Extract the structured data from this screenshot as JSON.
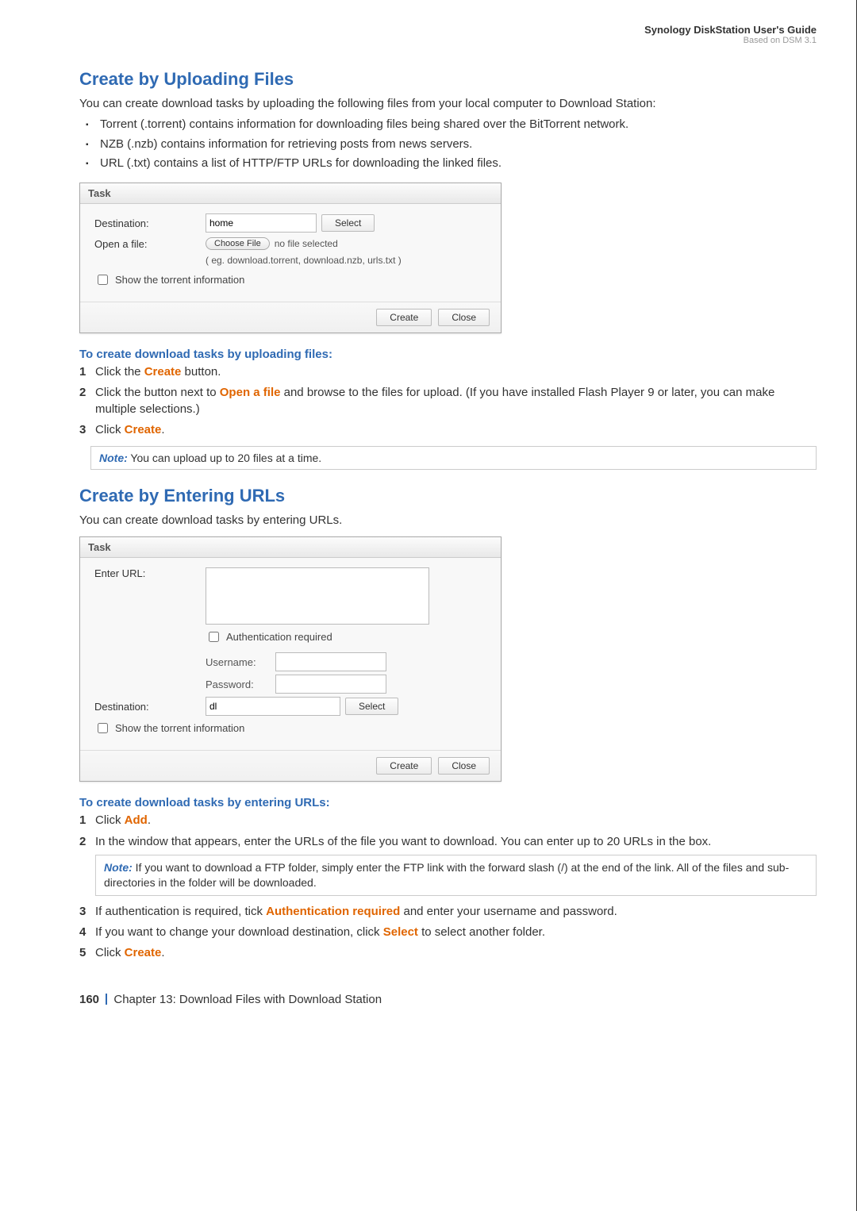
{
  "header": {
    "title": "Synology DiskStation User's Guide",
    "subtitle": "Based on DSM 3.1"
  },
  "section1": {
    "title": "Create by Uploading Files",
    "intro": "You can create download tasks by uploading the following files from your local computer to Download Station:",
    "bullets": [
      "Torrent (.torrent) contains information for downloading files being shared over the BitTorrent network.",
      "NZB (.nzb) contains information for retrieving posts from news servers.",
      "URL (.txt) contains a list of HTTP/FTP URLs for downloading the linked files."
    ],
    "dialog": {
      "title": "Task",
      "destinationLabel": "Destination:",
      "destinationValue": "home",
      "selectBtn": "Select",
      "openFileLabel": "Open a file:",
      "chooseFileBtn": "Choose File",
      "fileStatus": "no file selected",
      "hint": "( eg. download.torrent, download.nzb, urls.txt )",
      "showTorrentLabel": "Show the torrent information",
      "createBtn": "Create",
      "closeBtn": "Close"
    },
    "stepsHeading": "To create download tasks by uploading files:",
    "step1_a": "Click the ",
    "step1_b": "Create",
    "step1_c": " button.",
    "step2_a": "Click the button next to ",
    "step2_b": "Open a file",
    "step2_c": " and browse to the files for upload. (If you have installed Flash Player 9 or later, you can make multiple selections.)",
    "step3_a": "Click ",
    "step3_b": "Create",
    "step3_c": ".",
    "noteLabel": "Note:",
    "noteText": " You can upload up to 20 files at a time."
  },
  "section2": {
    "title": "Create by Entering URLs",
    "intro": "You can create download tasks by entering URLs.",
    "dialog": {
      "title": "Task",
      "enterUrlLabel": "Enter URL:",
      "authLabel": "Authentication required",
      "usernameLabel": "Username:",
      "passwordLabel": "Password:",
      "destinationLabel": "Destination:",
      "destinationValue": "dl",
      "selectBtn": "Select",
      "showTorrentLabel": "Show the torrent information",
      "createBtn": "Create",
      "closeBtn": "Close"
    },
    "stepsHeading": "To create download tasks by entering URLs:",
    "step1_a": "Click ",
    "step1_b": "Add",
    "step1_c": ".",
    "step2": "In the window that appears, enter the URLs of the file you want to download. You can enter up to 20 URLs in the box.",
    "note2Label": "Note:",
    "note2Text": " If you want to download a FTP folder, simply enter the FTP link with the forward slash (/) at the end of the link. All of the files and sub-directories in the folder will be downloaded.",
    "step3_a": "If authentication is required, tick ",
    "step3_b": "Authentication required",
    "step3_c": " and enter your username and password.",
    "step4_a": "If you want to change your download destination, click ",
    "step4_b": "Select",
    "step4_c": " to select another folder.",
    "step5_a": "Click ",
    "step5_b": "Create",
    "step5_c": "."
  },
  "footer": {
    "pageNum": "160",
    "chapter": "Chapter 13: Download Files with Download Station"
  }
}
